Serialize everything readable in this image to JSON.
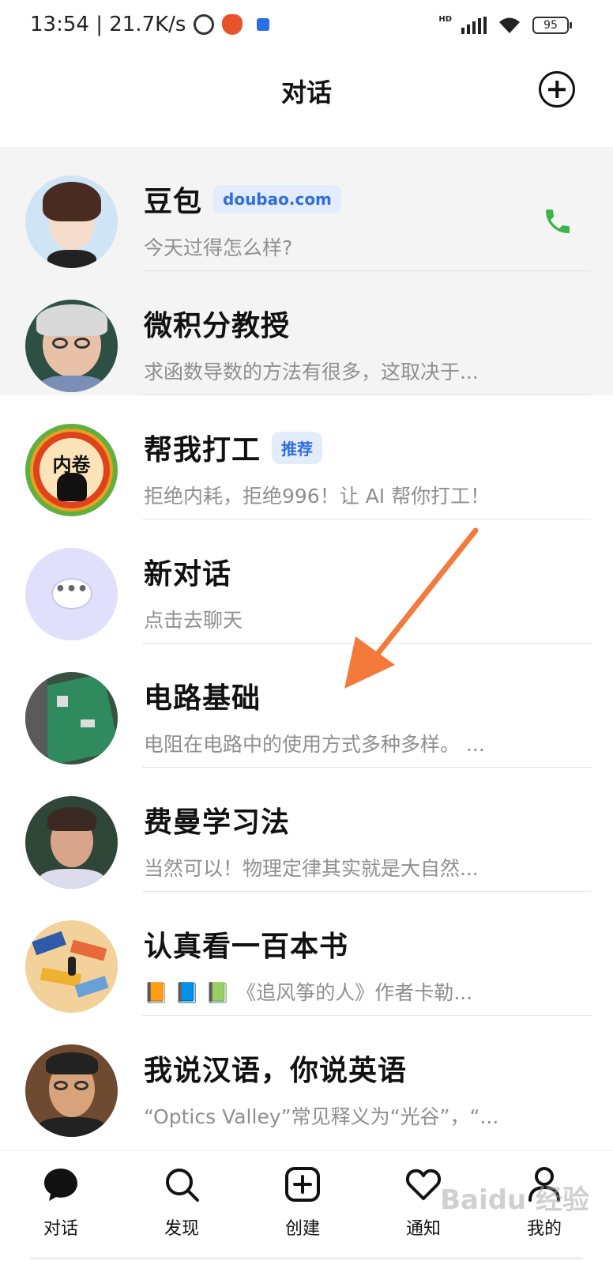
{
  "status_bar": {
    "time_speed": "13:54 | 21.7K/s",
    "hd": "HD",
    "battery": "95"
  },
  "header": {
    "title": "对话"
  },
  "chats": [
    {
      "name": "豆包",
      "tag": "doubao.com",
      "preview": "今天过得怎么样?",
      "icon": "phone-icon"
    },
    {
      "name": "微积分教授",
      "tag": "",
      "preview": "求函数导数的方法有很多，这取决于..."
    },
    {
      "name": "帮我打工",
      "tag": "推荐",
      "preview": "拒绝内耗，拒绝996！让 AI 帮你打工！"
    },
    {
      "name": "新对话",
      "tag": "",
      "preview": "点击去聊天"
    },
    {
      "name": "电路基础",
      "tag": "",
      "preview": "电阻在电路中的使用方式多种多样。 ..."
    },
    {
      "name": "费曼学习法",
      "tag": "",
      "preview": "当然可以！物理定律其实就是大自然..."
    },
    {
      "name": "认真看一百本书",
      "tag": "",
      "preview": "📙 📘 📗 《追风筝的人》作者卡勒..."
    },
    {
      "name": "我说汉语，你说英语",
      "tag": "",
      "preview": "“Optics Valley”常见释义为“光谷”，“..."
    }
  ],
  "avatar_badge": {
    "avatar_3_text": "内卷"
  },
  "bottom_nav": [
    {
      "label": "对话",
      "icon": "chat-bubble-icon"
    },
    {
      "label": "发现",
      "icon": "search-icon"
    },
    {
      "label": "创建",
      "icon": "add-square-icon"
    },
    {
      "label": "通知",
      "icon": "heart-icon"
    },
    {
      "label": "我的",
      "icon": "person-icon"
    }
  ],
  "watermark": "Baidu 经验",
  "colors": {
    "accent_blue": "#2f6fdc",
    "phone_green": "#3bb54a",
    "arrow_orange": "#f47a3c"
  }
}
